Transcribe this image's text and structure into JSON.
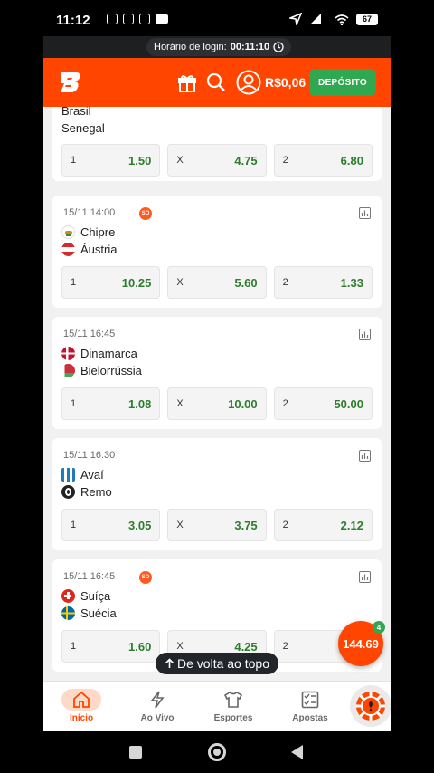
{
  "status_bar": {
    "time": "11:12",
    "battery": "67",
    "signal": "4G"
  },
  "login_bar": {
    "label": "Horário de login:",
    "duration": "00:11:10"
  },
  "header": {
    "balance": "R$0,06",
    "deposit_label": "DEPÓSITO"
  },
  "matches": [
    {
      "datetime": "",
      "so": false,
      "home": "Brasil",
      "away": "Senegal",
      "odds": [
        {
          "label": "1",
          "value": "1.50"
        },
        {
          "label": "X",
          "value": "4.75"
        },
        {
          "label": "2",
          "value": "6.80"
        }
      ]
    },
    {
      "datetime": "15/11 14:00",
      "so": true,
      "so_label": "SO",
      "home": "Chipre",
      "away": "Áustria",
      "odds": [
        {
          "label": "1",
          "value": "10.25"
        },
        {
          "label": "X",
          "value": "5.60"
        },
        {
          "label": "2",
          "value": "1.33"
        }
      ]
    },
    {
      "datetime": "15/11 16:45",
      "so": false,
      "home": "Dinamarca",
      "away": "Bielorrússia",
      "odds": [
        {
          "label": "1",
          "value": "1.08"
        },
        {
          "label": "X",
          "value": "10.00"
        },
        {
          "label": "2",
          "value": "50.00"
        }
      ]
    },
    {
      "datetime": "15/11 16:30",
      "so": false,
      "home": "Avaí",
      "away": "Remo",
      "odds": [
        {
          "label": "1",
          "value": "3.05"
        },
        {
          "label": "X",
          "value": "3.75"
        },
        {
          "label": "2",
          "value": "2.12"
        }
      ]
    },
    {
      "datetime": "15/11 16:45",
      "so": true,
      "so_label": "SO",
      "home": "Suíça",
      "away": "Suécia",
      "odds": [
        {
          "label": "1",
          "value": "1.60"
        },
        {
          "label": "X",
          "value": "4.25"
        },
        {
          "label": "2",
          "value": ""
        }
      ]
    }
  ],
  "back_to_top": "De volta ao topo",
  "betslip": {
    "amount": "144.69",
    "count": "4"
  },
  "nav": [
    {
      "label": "Início",
      "icon": "home-icon"
    },
    {
      "label": "Ao Vivo",
      "icon": "lightning-icon"
    },
    {
      "label": "Esportes",
      "icon": "shirt-icon"
    },
    {
      "label": "Apostas",
      "icon": "checklist-icon"
    }
  ],
  "colors": {
    "brand": "#ff4500",
    "deposit": "#2fa84f",
    "odds_value": "#2e7d2e"
  }
}
